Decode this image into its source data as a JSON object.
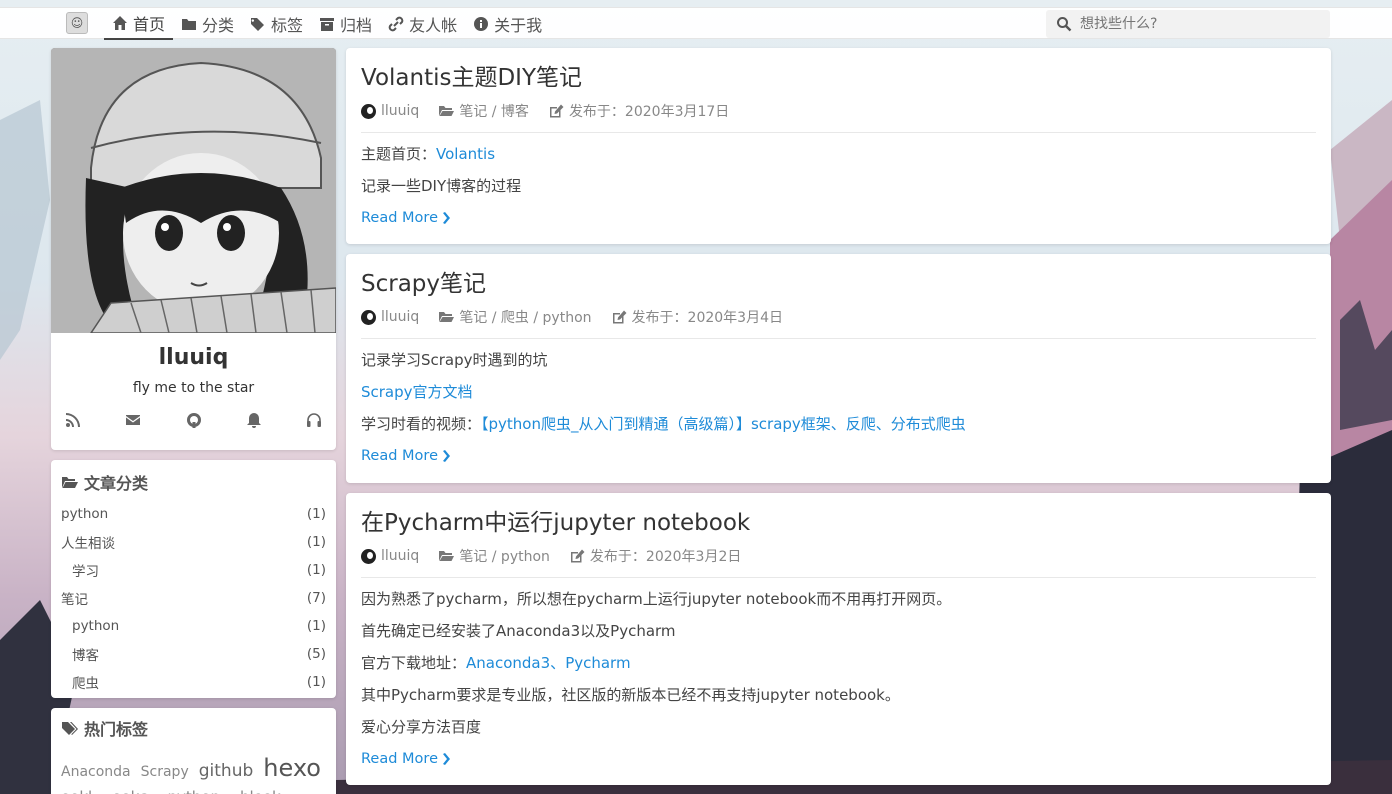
{
  "nav": {
    "items": [
      {
        "label": "首页",
        "icon": "home-icon"
      },
      {
        "label": "分类",
        "icon": "folder-icon"
      },
      {
        "label": "标签",
        "icon": "tags-icon"
      },
      {
        "label": "归档",
        "icon": "archive-icon"
      },
      {
        "label": "友人帐",
        "icon": "link-icon"
      },
      {
        "label": "关于我",
        "icon": "info-icon"
      }
    ],
    "search_placeholder": "想找些什么?"
  },
  "author": {
    "name": "lluuiq",
    "bio": "fly me to the star",
    "social": [
      "rss-icon",
      "mail-icon",
      "github-icon",
      "bell-icon",
      "headphones-icon"
    ]
  },
  "categories": {
    "title": "文章分类",
    "items": [
      {
        "name": "python",
        "count": "(1)",
        "child": false
      },
      {
        "name": "人生相谈",
        "count": "(1)",
        "child": false
      },
      {
        "name": "学习",
        "count": "(1)",
        "child": true
      },
      {
        "name": "笔记",
        "count": "(7)",
        "child": false
      },
      {
        "name": "python",
        "count": "(1)",
        "child": true
      },
      {
        "name": "博客",
        "count": "(5)",
        "child": true
      },
      {
        "name": "爬虫",
        "count": "(1)",
        "child": true
      }
    ]
  },
  "tags": {
    "title": "热门标签",
    "items": [
      "Anaconda",
      "Scrapy",
      "github",
      "hexo"
    ],
    "row2": [
      "ookl",
      "ookc",
      "python",
      "blook"
    ]
  },
  "posts": [
    {
      "title": "Volantis主题DIY笔记",
      "author": "lluuiq",
      "category": "笔记 / 博客",
      "date": "发布于：2020年3月17日",
      "p1_prefix": "主题首页：",
      "p1_link": "Volantis",
      "p2": "记录一些DIY博客的过程",
      "readmore": "Read More"
    },
    {
      "title": "Scrapy笔记",
      "author": "lluuiq",
      "category": "笔记 / 爬虫 / python",
      "date": "发布于：2020年3月4日",
      "p1": "记录学习Scrapy时遇到的坑",
      "p2_link": "Scrapy官方文档",
      "p3_prefix": "学习时看的视频：",
      "p3_link": "【python爬虫_从入门到精通（高级篇）】scrapy框架、反爬、分布式爬虫",
      "readmore": "Read More"
    },
    {
      "title": "在Pycharm中运行jupyter notebook",
      "author": "lluuiq",
      "category": "笔记 / python",
      "date": "发布于：2020年3月2日",
      "p1": "因为熟悉了pycharm，所以想在pycharm上运行jupyter notebook而不用再打开网页。",
      "p2": "首先确定已经安装了Anaconda3以及Pycharm",
      "p3_prefix": "官方下载地址：",
      "p3_link1": "Anaconda3",
      "p3_sep": "、",
      "p3_link2": "Pycharm",
      "p4": "其中Pycharm要求是专业版，社区版的新版本已经不再支持jupyter notebook。",
      "p5": "爱心分享方法百度",
      "readmore": "Read More"
    }
  ]
}
